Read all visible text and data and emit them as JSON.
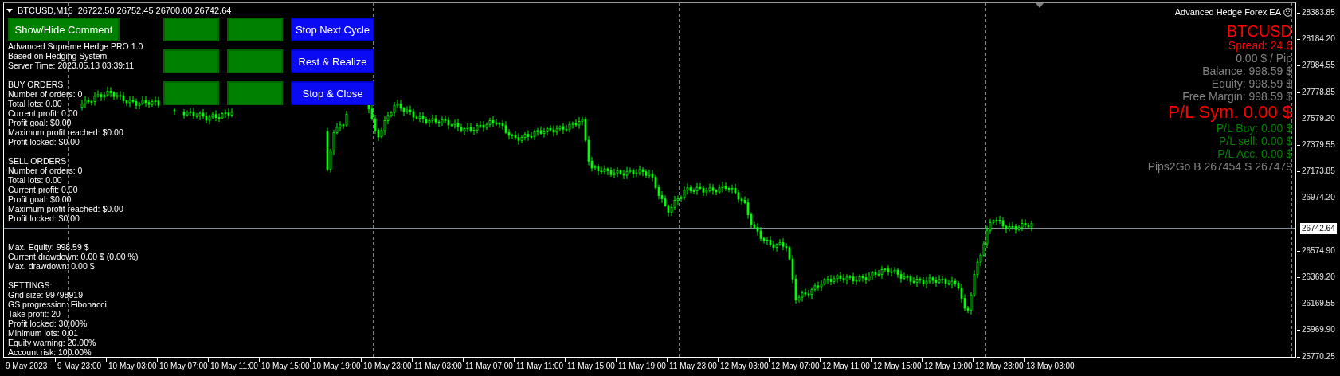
{
  "chart_header": {
    "symbol": "BTCUSD,M15",
    "quote": "26722.50 26752.45 26700.00 26742.64"
  },
  "toggle_button": {
    "label": "Show/Hide Comment"
  },
  "button_grid": [
    [
      {
        "kind": "blank"
      },
      {
        "kind": "blank"
      },
      {
        "kind": "action",
        "label": "Stop Next Cycle"
      }
    ],
    [
      {
        "kind": "blank"
      },
      {
        "kind": "blank"
      },
      {
        "kind": "action",
        "label": "Rest & Realize"
      }
    ],
    [
      {
        "kind": "blank"
      },
      {
        "kind": "blank"
      },
      {
        "kind": "action",
        "label": "Stop & Close"
      }
    ]
  ],
  "comment": [
    {
      "kind": "header",
      "lines": [
        "Advanced Supreme Hedge PRO 1.0",
        "Based on Hedging System",
        "Server Time: 2023.05.13 03:39:11"
      ]
    },
    {
      "kind": "orders",
      "lines": [
        "BUY ORDERS",
        "Number of orders: 0",
        "Total lots: 0.00",
        "Current profit: 0.00",
        "Profit goal: $0.00",
        "Maximum profit reached: $0.00",
        "Profit locked: $0.00"
      ]
    },
    {
      "kind": "orders",
      "lines": [
        "SELL ORDERS",
        "Number of orders: 0",
        "Total lots: 0.00",
        "Current profit: 0.00",
        "Profit goal: $0.00",
        "Maximum profit reached: $0.00",
        "Profit locked: $0.00"
      ]
    },
    {
      "kind": "account",
      "lines": [
        "Max. Equity: 998.59 $",
        "Current drawdown: 0.00 $ (0.00 %)",
        "Max. drawdown: 0.00 $"
      ]
    },
    {
      "kind": "settings",
      "lines": [
        "SETTINGS:",
        "Grid size: 99798919",
        "GS progression: Fibonacci",
        "Take profit: 20",
        "Profit locked: 30.00%",
        "Minimum lots: 0.01",
        "Equity warning: 20.00%",
        "Account risk: 100.00%"
      ]
    }
  ],
  "info_panel": {
    "title": "Advanced Hedge Forex EA",
    "lines": [
      {
        "kind": "symbol",
        "text": "BTCUSD",
        "color": "#ff0000"
      },
      {
        "kind": "line",
        "text": "Spread: 24.6",
        "color": "#ff0000"
      },
      {
        "kind": "line",
        "text": "0.00 $ / Pip",
        "color": "#808080"
      },
      {
        "kind": "line",
        "text": "Balance: 998.59 $",
        "color": "#808080"
      },
      {
        "kind": "line",
        "text": "Equity: 998.59 $",
        "color": "#808080"
      },
      {
        "kind": "line",
        "text": "Free Margin: 998.59 $",
        "color": "#808080"
      },
      {
        "kind": "total",
        "text": "P/L Sym. 0.00 $",
        "color": "#ff0000"
      },
      {
        "kind": "line",
        "text": "P/L Buy: 0.00 $",
        "color": "#008000"
      },
      {
        "kind": "line",
        "text": "P/L sell: 0.00 $",
        "color": "#008000"
      },
      {
        "kind": "line",
        "text": "P/L Acc. 0.00 $",
        "color": "#008000"
      },
      {
        "kind": "line",
        "text": "Pips2Go B 267454 S 267479",
        "color": "#808080"
      }
    ]
  },
  "price_axis": {
    "labels": [
      "28383.85",
      "28184.20",
      "27984.55",
      "27778.85",
      "27579.20",
      "27379.55",
      "27173.85",
      "26974.20",
      "26574.90",
      "26369.20",
      "26169.55",
      "25969.90",
      "25770.25"
    ],
    "current_price": "26742.64"
  },
  "time_axis": {
    "labels": [
      "9 May 2023",
      "9 May 23:00",
      "10 May 03:00",
      "10 May 07:00",
      "10 May 11:00",
      "10 May 15:00",
      "10 May 19:00",
      "10 May 23:00",
      "11 May 03:00",
      "11 May 07:00",
      "11 May 11:00",
      "11 May 15:00",
      "11 May 19:00",
      "11 May 23:00",
      "12 May 03:00",
      "12 May 07:00",
      "12 May 11:00",
      "12 May 15:00",
      "12 May 19:00",
      "12 May 23:00",
      "13 May 03:00"
    ]
  }
}
